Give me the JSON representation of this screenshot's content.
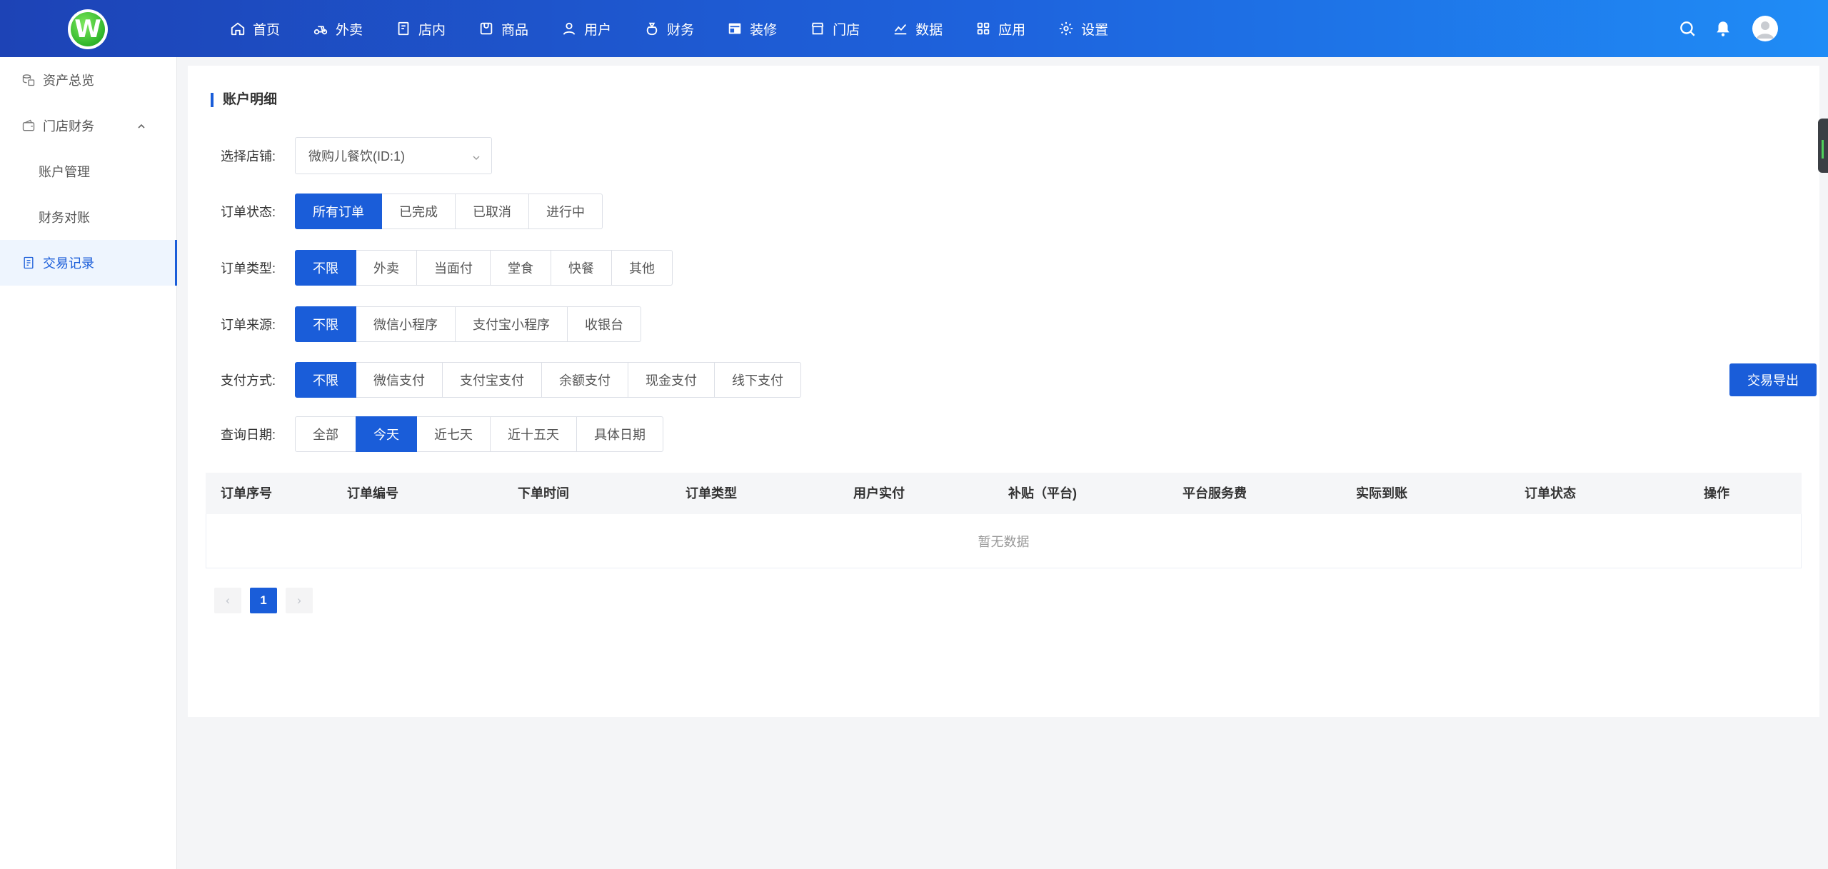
{
  "app": {
    "logo_letter": "W",
    "brand_color": "#1a5dd9"
  },
  "nav": {
    "items": [
      {
        "label": "首页",
        "icon": "home-icon"
      },
      {
        "label": "外卖",
        "icon": "scooter-icon"
      },
      {
        "label": "店内",
        "icon": "store-inside-icon"
      },
      {
        "label": "商品",
        "icon": "goods-icon"
      },
      {
        "label": "用户",
        "icon": "user-icon"
      },
      {
        "label": "财务",
        "icon": "money-bag-icon"
      },
      {
        "label": "装修",
        "icon": "decorate-icon"
      },
      {
        "label": "门店",
        "icon": "shop-icon"
      },
      {
        "label": "数据",
        "icon": "chart-icon"
      },
      {
        "label": "应用",
        "icon": "apps-icon"
      },
      {
        "label": "设置",
        "icon": "gear-icon"
      }
    ]
  },
  "sidebar": {
    "items": [
      {
        "label": "资产总览"
      },
      {
        "label": "门店财务"
      },
      {
        "label": "账户管理"
      },
      {
        "label": "财务对账"
      },
      {
        "label": "交易记录"
      }
    ]
  },
  "page": {
    "title": "账户明细",
    "store_label": "选择店铺:",
    "store_value": "微购儿餐饮(ID:1)",
    "filters": {
      "status": {
        "label": "订单状态:",
        "options": [
          "所有订单",
          "已完成",
          "已取消",
          "进行中"
        ],
        "selected": "所有订单"
      },
      "type": {
        "label": "订单类型:",
        "options": [
          "不限",
          "外卖",
          "当面付",
          "堂食",
          "快餐",
          "其他"
        ],
        "selected": "不限"
      },
      "source": {
        "label": "订单来源:",
        "options": [
          "不限",
          "微信小程序",
          "支付宝小程序",
          "收银台"
        ],
        "selected": "不限"
      },
      "payment": {
        "label": "支付方式:",
        "options": [
          "不限",
          "微信支付",
          "支付宝支付",
          "余额支付",
          "现金支付",
          "线下支付"
        ],
        "selected": "不限"
      },
      "date": {
        "label": "查询日期:",
        "options": [
          "全部",
          "今天",
          "近七天",
          "近十五天",
          "具体日期"
        ],
        "selected": "今天"
      }
    },
    "export_label": "交易导出",
    "table": {
      "columns": [
        "订单序号",
        "订单编号",
        "下单时间",
        "订单类型",
        "用户实付",
        "补贴（平台)",
        "平台服务费",
        "实际到账",
        "订单状态",
        "操作"
      ],
      "empty_text": "暂无数据"
    },
    "pagination": {
      "prev": "‹",
      "current": "1",
      "next": "›"
    }
  }
}
